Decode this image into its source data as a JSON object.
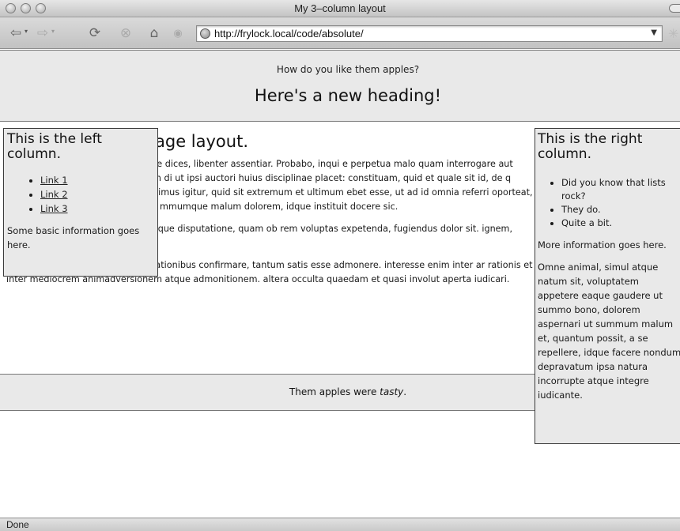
{
  "window": {
    "title": "My 3–column layout"
  },
  "toolbar": {
    "back_icon": "back-arrow-icon",
    "forward_icon": "forward-arrow-icon",
    "url": "http://frylock.local/code/absolute/"
  },
  "header": {
    "tagline": "How do you like them apples?",
    "heading": "Here's a new heading!"
  },
  "main": {
    "heading": "age layout.",
    "paragraphs": [
      "o tibique, si mihi probabis ea, quae dices, libenter assentiar. Probabo, inqui e perpetua malo quam interrogare aut interrogari. Ut placet, inquam. Tum di ut ipsi auctori huius disciplinae placet: constituam, quid et quale sit id, de q tione et via procedat oratio. quaerimus igitur, quid sit extremum et ultimum ebet esse, ut ad id omnia referri oporteat, ipsum autem nusquam. hoc Epicu mmumque malum dolorem, idque instituit docere sic.",
      "Itaque negat opus esse ratione neque disputatione, quam ob rem voluptas expetenda, fugiendus dolor sit. ignem, nivem esse albam, dulce mel.",
      "Quorum nihil oportere exquisitis rationibus confirmare, tantum satis esse admonere. interesse enim inter ar rationis et inter mediocrem animadversionem atque admonitionem. altera occulta quaedam et quasi involut aperta iudicari."
    ]
  },
  "left_column": {
    "title": "This is the left column.",
    "links": [
      "Link 1",
      "Link 2",
      "Link 3"
    ],
    "info": "Some basic information goes here."
  },
  "right_column": {
    "title": "This is the right column.",
    "items": [
      "Did you know that lists rock?",
      "They do.",
      "Quite a bit."
    ],
    "info": "More information goes here.",
    "paragraph": "Omne animal, simul atque natum sit, voluptatem appetere eaque gaudere ut summo bono, dolorem aspernari ut summum malum et, quantum possit, a se repellere, idque facere nondum depravatum ipsa natura incorrupte atque integre iudicante."
  },
  "footer": {
    "prefix": "Them apples were ",
    "emphasis": "tasty",
    "suffix": "."
  },
  "status": {
    "text": "Done"
  }
}
